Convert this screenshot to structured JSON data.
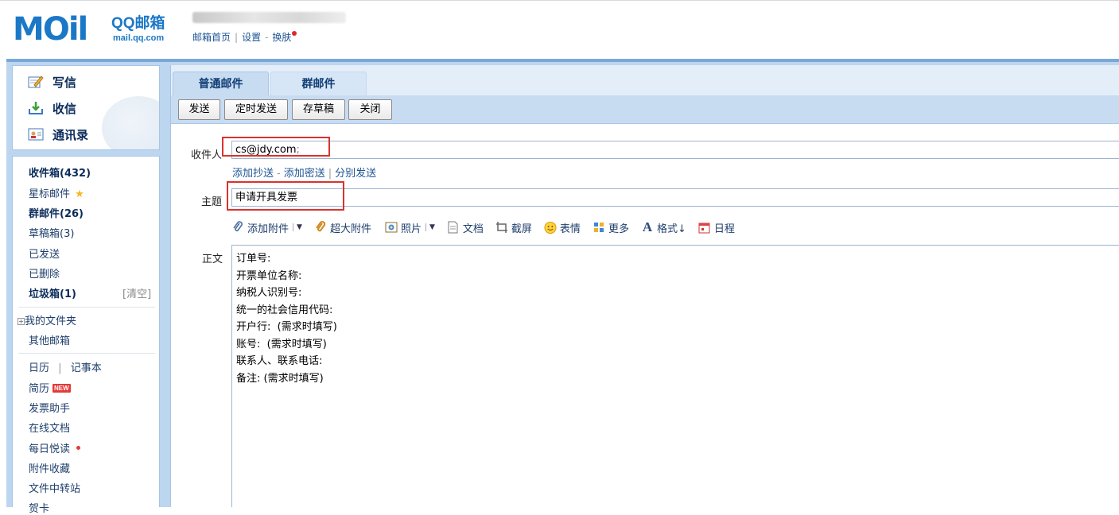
{
  "header": {
    "logo_text": "MOil",
    "brand": "QQ邮箱",
    "brand_url": "mail.qq.com",
    "links": [
      "邮箱首页",
      "设置",
      "换肤"
    ]
  },
  "nav": {
    "primary": [
      {
        "label": "写信",
        "icon": "pencil-paper-icon"
      },
      {
        "label": "收信",
        "icon": "download-tray-icon"
      },
      {
        "label": "通讯录",
        "icon": "contact-card-icon"
      }
    ],
    "folders": {
      "inbox": "收件箱(432)",
      "starred": "星标邮件",
      "group": "群邮件(26)",
      "drafts": "草稿箱(3)",
      "sent": "已发送",
      "deleted": "已删除",
      "spam": "垃圾箱(1)",
      "spam_clear": "[清空]",
      "my_folders": "我的文件夹",
      "other_mailbox": "其他邮箱",
      "calendar": "日历",
      "notebook": "记事本",
      "resume": "简历",
      "resume_badge": "NEW",
      "invoice_helper": "发票助手",
      "online_docs": "在线文档",
      "daily_read": "每日悦读",
      "attachment_favs": "附件收藏",
      "file_transfer": "文件中转站",
      "greeting_card": "贺卡"
    }
  },
  "compose": {
    "tabs": [
      "普通邮件",
      "群邮件"
    ],
    "toolbar": [
      "发送",
      "定时发送",
      "存草稿",
      "关闭"
    ],
    "to_label": "收件人",
    "to_value": "cs@jdy.com",
    "to_sep": ";",
    "to_links": [
      "添加抄送",
      "添加密送",
      "分别发送"
    ],
    "subject_label": "主题",
    "subject_value": "申请开具发票",
    "attach_items": [
      "添加附件",
      "超大附件",
      "照片",
      "文档",
      "截屏",
      "表情",
      "更多",
      "格式↓",
      "日程"
    ],
    "body_label": "正文",
    "body_lines": [
      "订单号:",
      "开票单位名称:",
      "纳税人识别号:",
      "统一的社会信用代码:",
      "开户行:  (需求时填写)",
      "账号:  (需求时填写)",
      "联系人、联系电话:",
      "备注: (需求时填写)"
    ]
  },
  "colors": {
    "brand_blue": "#1b78c7",
    "frame_blue": "#bdd6ef",
    "toolbar_blue": "#c8dcf1",
    "highlight_red": "#d9332e"
  }
}
